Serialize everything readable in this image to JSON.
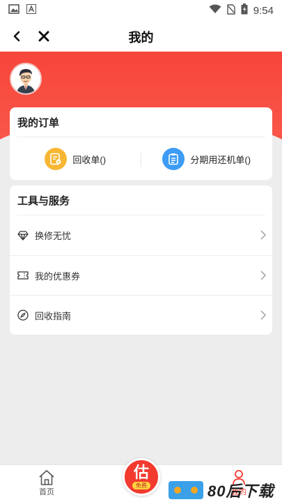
{
  "status_bar": {
    "time": "9:54",
    "icons": [
      "image-icon",
      "text-a-icon",
      "wifi-icon",
      "no-sim-icon",
      "battery-icon"
    ]
  },
  "nav": {
    "title": "我的",
    "back_icon": "chevron-left-icon",
    "close_icon": "close-icon"
  },
  "profile": {
    "avatar_icon": "avatar-man-icon"
  },
  "orders": {
    "title": "我的订单",
    "items": [
      {
        "label": "回收单()",
        "icon": "recycle-order-icon",
        "color": "#f7b733"
      },
      {
        "label": "分期用还机单()",
        "icon": "clipboard-icon",
        "color": "#3d9cf5"
      }
    ]
  },
  "services": {
    "title": "工具与服务",
    "items": [
      {
        "label": "换修无忧",
        "icon": "diamond-icon"
      },
      {
        "label": "我的优惠券",
        "icon": "ticket-icon"
      },
      {
        "label": "回收指南",
        "icon": "compass-icon"
      }
    ]
  },
  "tabbar": {
    "home_label": "首页",
    "estimate_glyph": "估",
    "estimate_badge": "免费",
    "mine_label": "我的"
  },
  "watermark": {
    "text": "80后下载"
  },
  "colors": {
    "accent": "#f7453a",
    "background": "#ededed"
  }
}
